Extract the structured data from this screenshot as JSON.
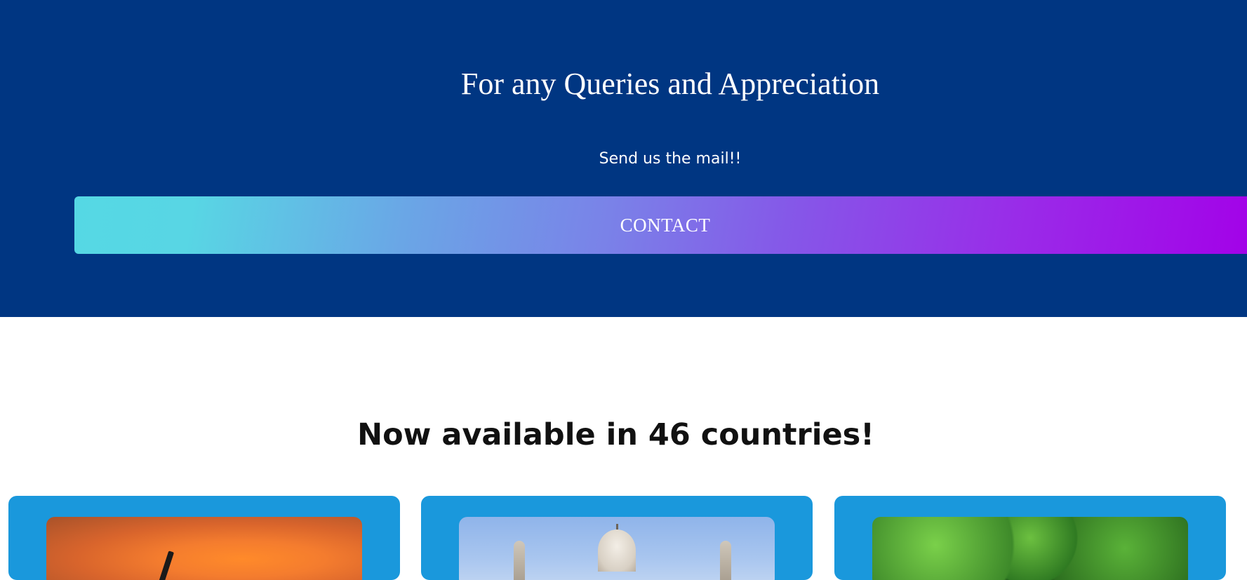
{
  "hero": {
    "title": "For any Queries and Appreciation",
    "subtitle": "Send us the mail!!",
    "contact_label": "CONTACT",
    "background": "#003682",
    "button_gradient": [
      "#55d8e4",
      "#a300e8"
    ]
  },
  "availability": {
    "title": "Now available in 46 countries!"
  },
  "cards": [
    {
      "image": "sunset-silhouette-photo"
    },
    {
      "image": "taj-mahal-photo"
    },
    {
      "image": "forest-photo"
    }
  ],
  "colors": {
    "card_background": "#1a98dc",
    "title_text": "#111111"
  }
}
